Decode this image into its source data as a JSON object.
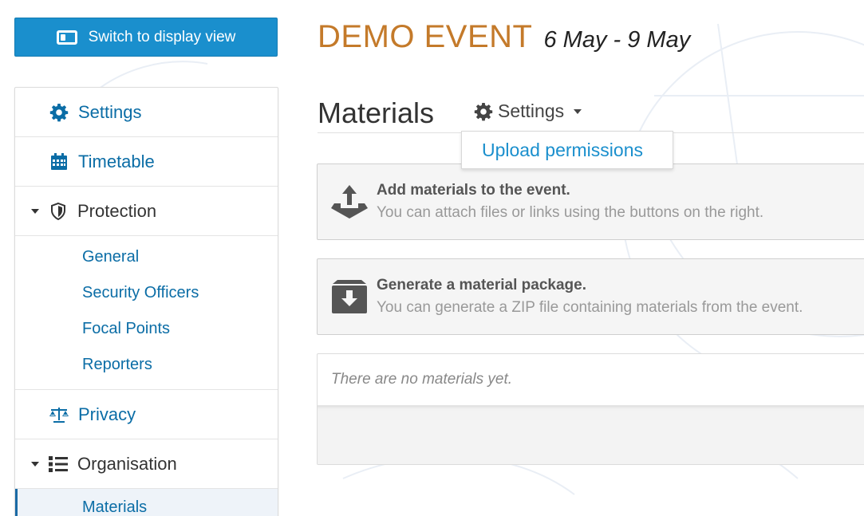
{
  "switch_button": {
    "label": "Switch to display view",
    "icon": "display-view-icon"
  },
  "event": {
    "name": "DEMO EVENT",
    "dates": "6 May - 9 May"
  },
  "sidebar": {
    "settings": {
      "label": "Settings",
      "icon": "gear-icon"
    },
    "timetable": {
      "label": "Timetable",
      "icon": "calendar-icon"
    },
    "protection": {
      "label": "Protection",
      "icon": "shield-icon",
      "items": [
        "General",
        "Security Officers",
        "Focal Points",
        "Reporters"
      ]
    },
    "privacy": {
      "label": "Privacy",
      "icon": "scales-icon"
    },
    "organisation": {
      "label": "Organisation",
      "icon": "list-icon",
      "items": [
        "Materials"
      ],
      "active": "Materials"
    }
  },
  "page": {
    "title": "Materials",
    "settings_dropdown": {
      "label": "Settings",
      "icon": "gear-icon"
    },
    "dropdown_menu": {
      "items": [
        "Upload permissions"
      ]
    }
  },
  "actions": {
    "add": {
      "title": "Add materials to the event.",
      "description": "You can attach files or links using the buttons on the right.",
      "icon": "upload-tray-icon"
    },
    "generate": {
      "title": "Generate a material package.",
      "description": "You can generate a ZIP file containing materials from the event.",
      "icon": "archive-box-icon"
    }
  },
  "materials_list": {
    "empty_message": "There are no materials yet."
  },
  "colors": {
    "accent": "#1a8fcd",
    "link": "#0b6da6",
    "event_title": "#c47a2a",
    "active_bar": "#1a6aa5"
  }
}
